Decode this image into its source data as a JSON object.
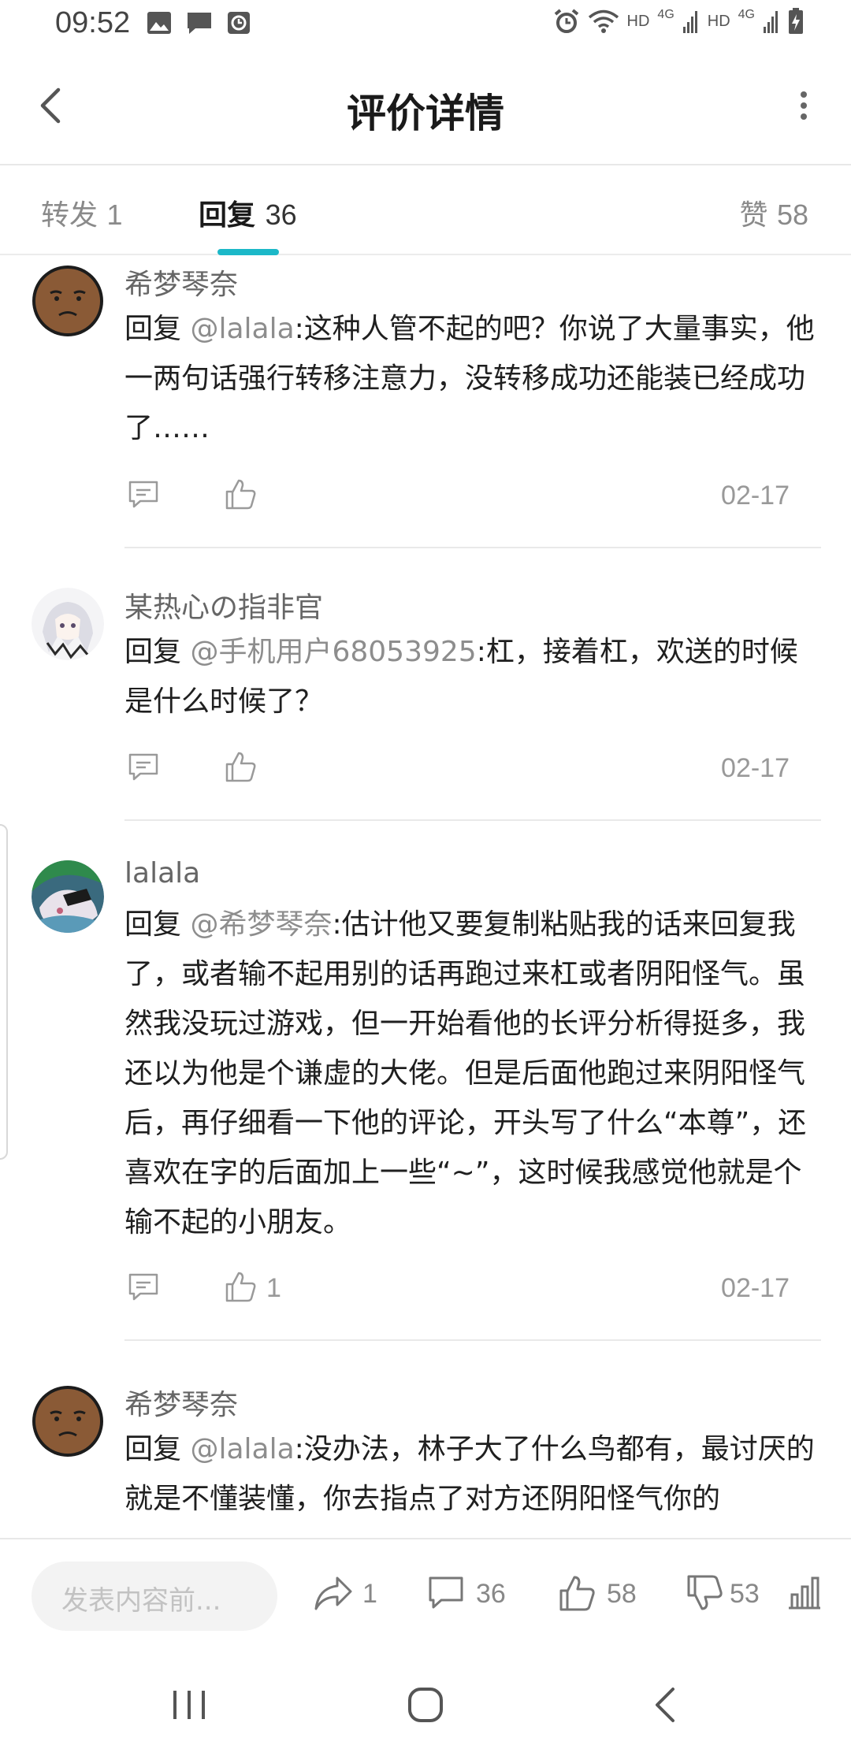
{
  "status_bar": {
    "time": "09:52",
    "hd1": "HD",
    "net1": "4G",
    "hd2": "HD",
    "net2": "4G"
  },
  "header": {
    "title": "评价详情"
  },
  "tabs": [
    {
      "label": "转发",
      "count": "1"
    },
    {
      "label": "回复",
      "count": "36",
      "active": true
    },
    {
      "label": "赞",
      "count": "58"
    }
  ],
  "comments": [
    {
      "author": "希梦琴奈",
      "avatar": "dark-face",
      "reply_prefix": "回复 ",
      "mention": "@lalala",
      "text": ":这种人管不起的吧？你说了大量事实，他一两句话强行转移注意力，没转移成功还能装已经成功了……",
      "likes": "",
      "date": "02-17"
    },
    {
      "author": "某热心の指非官",
      "avatar": "anime-girl",
      "reply_prefix": "回复 ",
      "mention": "@手机用户68053925",
      "text": ":杠，接着杠，欢送的时候是什么时候了？",
      "likes": "",
      "date": "02-17"
    },
    {
      "author": "lalala",
      "avatar": "anime-green",
      "reply_prefix": "回复 ",
      "mention": "@希梦琴奈",
      "text": ":估计他又要复制粘贴我的话来回复我了，或者输不起用别的话再跑过来杠或者阴阳怪气。虽然我没玩过游戏，但一开始看他的长评分析得挺多，我还以为他是个谦虚的大佬。但是后面他跑过来阴阳怪气后，再仔细看一下他的评论，开头写了什么“本尊”，还喜欢在字的后面加上一些“~”，这时候我感觉他就是个输不起的小朋友。",
      "likes": "1",
      "date": "02-17"
    },
    {
      "author": "希梦琴奈",
      "avatar": "dark-face",
      "reply_prefix": "回复 ",
      "mention": "@lalala",
      "text": ":没办法，林子大了什么鸟都有，最讨厌的就是不懂装懂，你去指点了对方还阴阳怪气你的",
      "likes": "",
      "date": ""
    }
  ],
  "bottom_bar": {
    "input_placeholder": "发表内容前...",
    "share_count": "1",
    "comment_count": "36",
    "like_count": "58",
    "dislike_count": "53"
  },
  "colors": {
    "accent": "#1cb8c8",
    "mention": "#8d8d8d",
    "muted": "#999999"
  }
}
